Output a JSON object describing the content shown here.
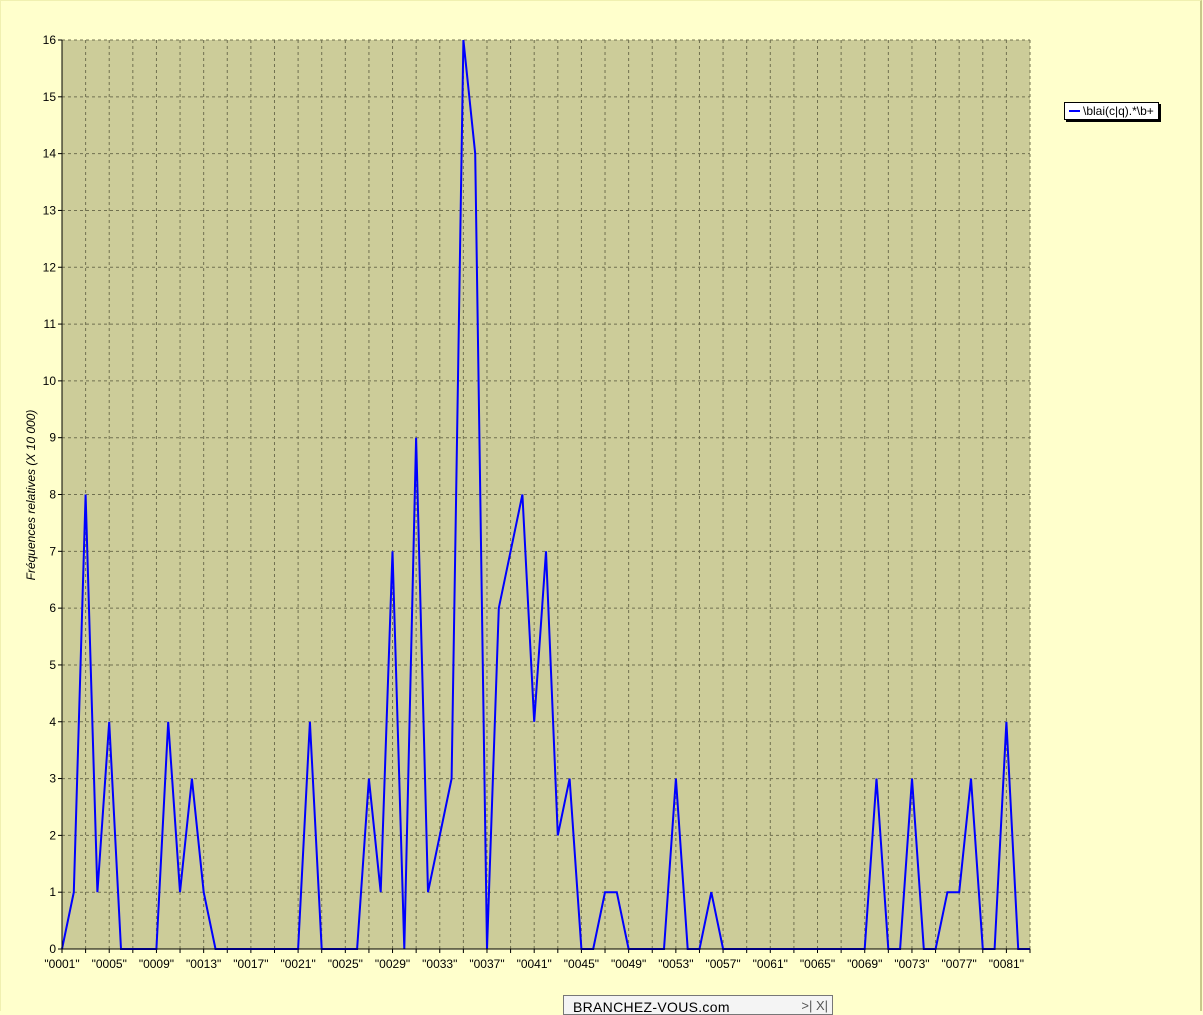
{
  "chart_data": {
    "type": "line",
    "ylabel": "Fréquences relatives (X 10 000)",
    "xlabel": "",
    "ylim": [
      0,
      16
    ],
    "yticks": [
      0,
      1,
      2,
      3,
      4,
      5,
      6,
      7,
      8,
      9,
      10,
      11,
      12,
      13,
      14,
      15,
      16
    ],
    "grid": true,
    "legend_position": "right",
    "x_tick_labels": [
      "\"0001\"",
      "\"0005\"",
      "\"0009\"",
      "\"0013\"",
      "\"0017\"",
      "\"0021\"",
      "\"0025\"",
      "\"0029\"",
      "\"0033\"",
      "\"0037\"",
      "\"0041\"",
      "\"0045\"",
      "\"0049\"",
      "\"0053\"",
      "\"0057\"",
      "\"0061\"",
      "\"0065\"",
      "\"0069\"",
      "\"0073\"",
      "\"0077\"",
      "\"0081\""
    ],
    "x_first": 1,
    "x_last": 83,
    "tick_step": 4,
    "series": [
      {
        "name": "\\blai(c|q).*\\b+",
        "color": "#0000ff",
        "values": [
          0,
          1,
          8,
          1,
          4,
          0,
          0,
          0,
          0,
          4,
          1,
          3,
          1,
          0,
          0,
          0,
          0,
          0,
          0,
          0,
          0,
          4,
          0,
          0,
          0,
          0,
          3,
          1,
          7,
          0,
          9,
          1,
          2,
          3,
          16,
          14,
          0,
          6,
          7,
          8,
          4,
          7,
          2,
          3,
          0,
          0,
          1,
          1,
          0,
          0,
          0,
          0,
          3,
          0,
          0,
          1,
          0,
          0,
          0,
          0,
          0,
          0,
          0,
          0,
          0,
          0,
          0,
          0,
          0,
          3,
          0,
          0,
          3,
          0,
          0,
          1,
          1,
          3,
          0,
          0,
          4,
          0,
          0
        ]
      }
    ]
  },
  "footer": {
    "brand": "BRANCHEZ-VOUS.com",
    "controls": ">| X|"
  }
}
